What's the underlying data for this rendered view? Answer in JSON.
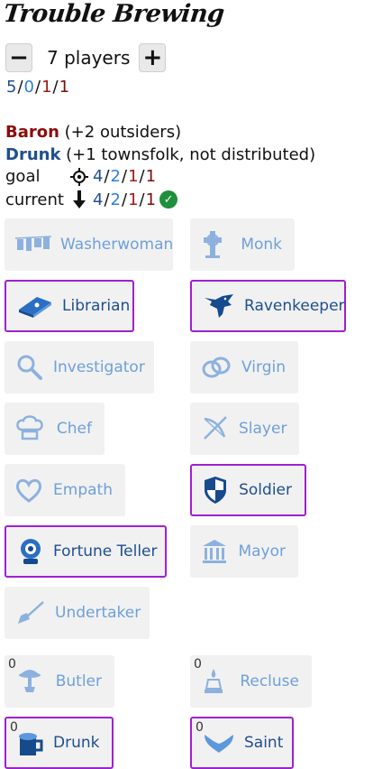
{
  "title": "Trouble Brewing",
  "stepper": {
    "minus_label": "−",
    "plus_label": "+",
    "players": "7 players"
  },
  "distribution": {
    "townsfolk": "5",
    "outsiders": "0",
    "minions": "1",
    "demons": "1"
  },
  "modifiers": [
    {
      "name": "Baron",
      "note": " (+2 outsiders)"
    },
    {
      "name": "Drunk",
      "note": " (+1 townsfolk, not distributed)"
    }
  ],
  "goal": {
    "label": "goal",
    "townsfolk": "4",
    "outsiders": "2",
    "minions": "1",
    "demons": "1"
  },
  "current": {
    "label": "current",
    "townsfolk": "4",
    "outsiders": "2",
    "minions": "1",
    "demons": "1"
  },
  "colors": {
    "townsfolk": "#1f4f8f",
    "outsiders": "#2e7ed6",
    "minions": "#a31818",
    "demons": "#7a0d0d",
    "selected_border": "#a020d0",
    "check": "#1e8f3a"
  },
  "characters": [
    {
      "name": "Washerwoman",
      "icon": "clothesline-icon",
      "selected": false
    },
    {
      "name": "Monk",
      "icon": "cross-icon",
      "selected": false
    },
    {
      "name": "Librarian",
      "icon": "book-icon",
      "selected": true
    },
    {
      "name": "Ravenkeeper",
      "icon": "raven-icon",
      "selected": true
    },
    {
      "name": "Investigator",
      "icon": "magnifier-icon",
      "selected": false
    },
    {
      "name": "Virgin",
      "icon": "rings-icon",
      "selected": false
    },
    {
      "name": "Chef",
      "icon": "chef-hat-icon",
      "selected": false
    },
    {
      "name": "Slayer",
      "icon": "crossbow-icon",
      "selected": false
    },
    {
      "name": "Empath",
      "icon": "heart-icon",
      "selected": false
    },
    {
      "name": "Soldier",
      "icon": "shield-icon",
      "selected": true
    },
    {
      "name": "Fortune Teller",
      "icon": "crystal-ball-icon",
      "selected": true
    },
    {
      "name": "Mayor",
      "icon": "building-icon",
      "selected": false
    },
    {
      "name": "Undertaker",
      "icon": "shovel-icon",
      "selected": false
    },
    {
      "name": "Butler",
      "icon": "tray-icon",
      "selected": false,
      "count": "0"
    },
    {
      "name": "Recluse",
      "icon": "lamp-icon",
      "selected": false,
      "count": "0"
    },
    {
      "name": "Drunk",
      "icon": "mug-icon",
      "selected": true,
      "count": "0"
    },
    {
      "name": "Saint",
      "icon": "wings-icon",
      "selected": true,
      "count": "0"
    }
  ]
}
